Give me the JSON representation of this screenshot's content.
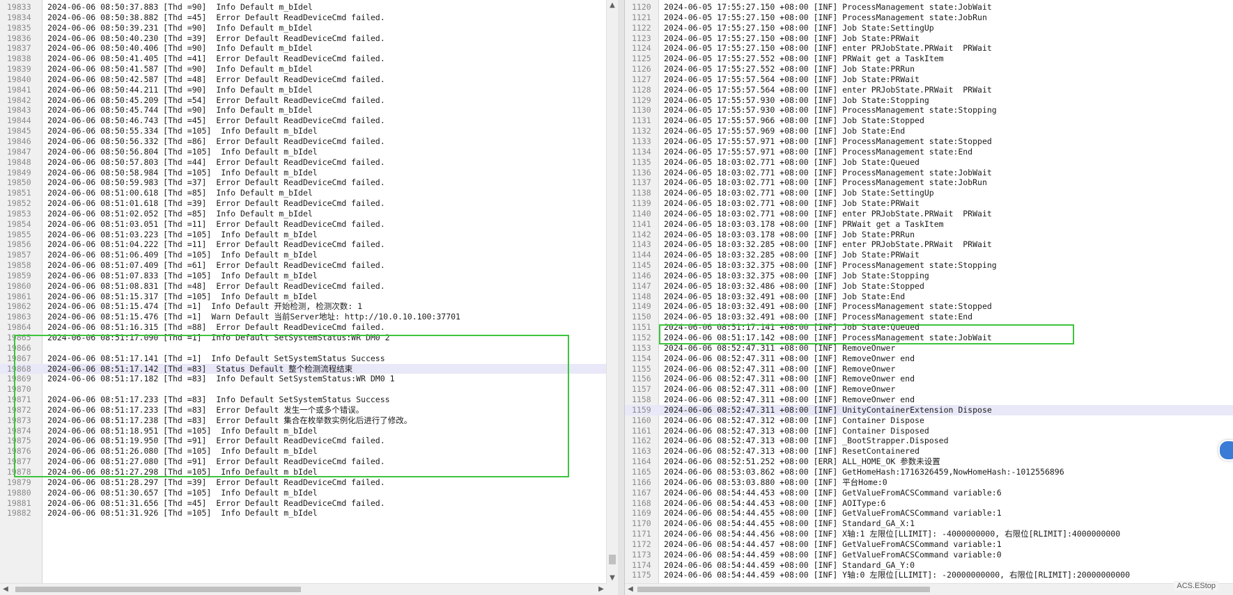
{
  "left_log": {
    "lines": [
      {
        "n": "19833",
        "t": "2024-06-06 08:50:37.883 [Thd =90]  Info Default m_bIdel"
      },
      {
        "n": "19834",
        "t": "2024-06-06 08:50:38.882 [Thd =45]  Error Default ReadDeviceCmd failed."
      },
      {
        "n": "19835",
        "t": "2024-06-06 08:50:39.231 [Thd =90]  Info Default m_bIdel"
      },
      {
        "n": "19836",
        "t": "2024-06-06 08:50:40.230 [Thd =39]  Error Default ReadDeviceCmd failed."
      },
      {
        "n": "19837",
        "t": "2024-06-06 08:50:40.406 [Thd =90]  Info Default m_bIdel"
      },
      {
        "n": "19838",
        "t": "2024-06-06 08:50:41.405 [Thd =41]  Error Default ReadDeviceCmd failed."
      },
      {
        "n": "19839",
        "t": "2024-06-06 08:50:41.587 [Thd =90]  Info Default m_bIdel"
      },
      {
        "n": "19840",
        "t": "2024-06-06 08:50:42.587 [Thd =48]  Error Default ReadDeviceCmd failed."
      },
      {
        "n": "19841",
        "t": "2024-06-06 08:50:44.211 [Thd =90]  Info Default m_bIdel"
      },
      {
        "n": "19842",
        "t": "2024-06-06 08:50:45.209 [Thd =54]  Error Default ReadDeviceCmd failed."
      },
      {
        "n": "19843",
        "t": "2024-06-06 08:50:45.744 [Thd =90]  Info Default m_bIdel"
      },
      {
        "n": "19844",
        "t": "2024-06-06 08:50:46.743 [Thd =45]  Error Default ReadDeviceCmd failed."
      },
      {
        "n": "19845",
        "t": "2024-06-06 08:50:55.334 [Thd =105]  Info Default m_bIdel"
      },
      {
        "n": "19846",
        "t": "2024-06-06 08:50:56.332 [Thd =86]  Error Default ReadDeviceCmd failed."
      },
      {
        "n": "19847",
        "t": "2024-06-06 08:50:56.804 [Thd =105]  Info Default m_bIdel"
      },
      {
        "n": "19848",
        "t": "2024-06-06 08:50:57.803 [Thd =44]  Error Default ReadDeviceCmd failed."
      },
      {
        "n": "19849",
        "t": "2024-06-06 08:50:58.984 [Thd =105]  Info Default m_bIdel"
      },
      {
        "n": "19850",
        "t": "2024-06-06 08:50:59.983 [Thd =37]  Error Default ReadDeviceCmd failed."
      },
      {
        "n": "19851",
        "t": "2024-06-06 08:51:00.618 [Thd =85]  Info Default m_bIdel"
      },
      {
        "n": "19852",
        "t": "2024-06-06 08:51:01.618 [Thd =39]  Error Default ReadDeviceCmd failed."
      },
      {
        "n": "19853",
        "t": "2024-06-06 08:51:02.052 [Thd =85]  Info Default m_bIdel"
      },
      {
        "n": "19854",
        "t": "2024-06-06 08:51:03.051 [Thd =11]  Error Default ReadDeviceCmd failed."
      },
      {
        "n": "19855",
        "t": "2024-06-06 08:51:03.223 [Thd =105]  Info Default m_bIdel"
      },
      {
        "n": "19856",
        "t": "2024-06-06 08:51:04.222 [Thd =11]  Error Default ReadDeviceCmd failed."
      },
      {
        "n": "19857",
        "t": "2024-06-06 08:51:06.409 [Thd =105]  Info Default m_bIdel"
      },
      {
        "n": "19858",
        "t": "2024-06-06 08:51:07.409 [Thd =61]  Error Default ReadDeviceCmd failed."
      },
      {
        "n": "19859",
        "t": "2024-06-06 08:51:07.833 [Thd =105]  Info Default m_bIdel"
      },
      {
        "n": "19860",
        "t": "2024-06-06 08:51:08.831 [Thd =48]  Error Default ReadDeviceCmd failed."
      },
      {
        "n": "19861",
        "t": "2024-06-06 08:51:15.317 [Thd =105]  Info Default m_bIdel"
      },
      {
        "n": "19862",
        "t": "2024-06-06 08:51:15.474 [Thd =1]  Info Default 开始检测, 检测次数: 1"
      },
      {
        "n": "19863",
        "t": "2024-06-06 08:51:15.476 [Thd =1]  Warn Default 当前Server地址: http://10.0.10.100:37701"
      },
      {
        "n": "19864",
        "t": "2024-06-06 08:51:16.315 [Thd =88]  Error Default ReadDeviceCmd failed."
      },
      {
        "n": "19865",
        "t": "2024-06-06 08:51:17.090 [Thd =1]  Info Default SetSystemStatus:WR DM0 2"
      },
      {
        "n": "19866",
        "t": ""
      },
      {
        "n": "19867",
        "t": "2024-06-06 08:51:17.141 [Thd =1]  Info Default SetSystemStatus Success"
      },
      {
        "n": "19868",
        "t": "2024-06-06 08:51:17.142 [Thd =83]  Status Default 整个检测流程结束"
      },
      {
        "n": "19869",
        "t": "2024-06-06 08:51:17.182 [Thd =83]  Info Default SetSystemStatus:WR DM0 1"
      },
      {
        "n": "19870",
        "t": ""
      },
      {
        "n": "19871",
        "t": "2024-06-06 08:51:17.233 [Thd =83]  Info Default SetSystemStatus Success"
      },
      {
        "n": "19872",
        "t": "2024-06-06 08:51:17.233 [Thd =83]  Error Default 发生一个或多个错误。"
      },
      {
        "n": "19873",
        "t": "2024-06-06 08:51:17.238 [Thd =83]  Error Default 集合在枚举数实例化后进行了修改。"
      },
      {
        "n": "19874",
        "t": "2024-06-06 08:51:18.951 [Thd =105]  Info Default m_bIdel"
      },
      {
        "n": "19875",
        "t": "2024-06-06 08:51:19.950 [Thd =91]  Error Default ReadDeviceCmd failed."
      },
      {
        "n": "19876",
        "t": "2024-06-06 08:51:26.080 [Thd =105]  Info Default m_bIdel"
      },
      {
        "n": "19877",
        "t": "2024-06-06 08:51:27.080 [Thd =91]  Error Default ReadDeviceCmd failed."
      },
      {
        "n": "19878",
        "t": "2024-06-06 08:51:27.298 [Thd =105]  Info Default m_bIdel"
      },
      {
        "n": "19879",
        "t": "2024-06-06 08:51:28.297 [Thd =39]  Error Default ReadDeviceCmd failed."
      },
      {
        "n": "19880",
        "t": "2024-06-06 08:51:30.657 [Thd =105]  Info Default m_bIdel"
      },
      {
        "n": "19881",
        "t": "2024-06-06 08:51:31.656 [Thd =45]  Error Default ReadDeviceCmd failed."
      },
      {
        "n": "19882",
        "t": "2024-06-06 08:51:31.926 [Thd =105]  Info Default m_bIdel"
      }
    ],
    "highlighted_line": "19868"
  },
  "right_log": {
    "lines": [
      {
        "n": "1120",
        "t": "2024-06-05 17:55:27.150 +08:00 [INF] ProcessManagement state:JobWait"
      },
      {
        "n": "1121",
        "t": "2024-06-05 17:55:27.150 +08:00 [INF] ProcessManagement state:JobRun"
      },
      {
        "n": "1122",
        "t": "2024-06-05 17:55:27.150 +08:00 [INF] Job State:SettingUp"
      },
      {
        "n": "1123",
        "t": "2024-06-05 17:55:27.150 +08:00 [INF] Job State:PRWait"
      },
      {
        "n": "1124",
        "t": "2024-06-05 17:55:27.150 +08:00 [INF] enter PRJobState.PRWait  PRWait"
      },
      {
        "n": "1125",
        "t": "2024-06-05 17:55:27.552 +08:00 [INF] PRWait get a TaskItem"
      },
      {
        "n": "1126",
        "t": "2024-06-05 17:55:27.552 +08:00 [INF] Job State:PRRun"
      },
      {
        "n": "1127",
        "t": "2024-06-05 17:55:57.564 +08:00 [INF] Job State:PRWait"
      },
      {
        "n": "1128",
        "t": "2024-06-05 17:55:57.564 +08:00 [INF] enter PRJobState.PRWait  PRWait"
      },
      {
        "n": "1129",
        "t": "2024-06-05 17:55:57.930 +08:00 [INF] Job State:Stopping"
      },
      {
        "n": "1130",
        "t": "2024-06-05 17:55:57.930 +08:00 [INF] ProcessManagement state:Stopping"
      },
      {
        "n": "1131",
        "t": "2024-06-05 17:55:57.966 +08:00 [INF] Job State:Stopped"
      },
      {
        "n": "1132",
        "t": "2024-06-05 17:55:57.969 +08:00 [INF] Job State:End"
      },
      {
        "n": "1133",
        "t": "2024-06-05 17:55:57.971 +08:00 [INF] ProcessManagement state:Stopped"
      },
      {
        "n": "1134",
        "t": "2024-06-05 17:55:57.971 +08:00 [INF] ProcessManagement state:End"
      },
      {
        "n": "1135",
        "t": "2024-06-05 18:03:02.771 +08:00 [INF] Job State:Queued"
      },
      {
        "n": "1136",
        "t": "2024-06-05 18:03:02.771 +08:00 [INF] ProcessManagement state:JobWait"
      },
      {
        "n": "1137",
        "t": "2024-06-05 18:03:02.771 +08:00 [INF] ProcessManagement state:JobRun"
      },
      {
        "n": "1138",
        "t": "2024-06-05 18:03:02.771 +08:00 [INF] Job State:SettingUp"
      },
      {
        "n": "1139",
        "t": "2024-06-05 18:03:02.771 +08:00 [INF] Job State:PRWait"
      },
      {
        "n": "1140",
        "t": "2024-06-05 18:03:02.771 +08:00 [INF] enter PRJobState.PRWait  PRWait"
      },
      {
        "n": "1141",
        "t": "2024-06-05 18:03:03.178 +08:00 [INF] PRWait get a TaskItem"
      },
      {
        "n": "1142",
        "t": "2024-06-05 18:03:03.178 +08:00 [INF] Job State:PRRun"
      },
      {
        "n": "1143",
        "t": "2024-06-05 18:03:32.285 +08:00 [INF] enter PRJobState.PRWait  PRWait"
      },
      {
        "n": "1144",
        "t": "2024-06-05 18:03:32.285 +08:00 [INF] Job State:PRWait"
      },
      {
        "n": "1145",
        "t": "2024-06-05 18:03:32.375 +08:00 [INF] ProcessManagement state:Stopping"
      },
      {
        "n": "1146",
        "t": "2024-06-05 18:03:32.375 +08:00 [INF] Job State:Stopping"
      },
      {
        "n": "1147",
        "t": "2024-06-05 18:03:32.486 +08:00 [INF] Job State:Stopped"
      },
      {
        "n": "1148",
        "t": "2024-06-05 18:03:32.491 +08:00 [INF] Job State:End"
      },
      {
        "n": "1149",
        "t": "2024-06-05 18:03:32.491 +08:00 [INF] ProcessManagement state:Stopped"
      },
      {
        "n": "1150",
        "t": "2024-06-05 18:03:32.491 +08:00 [INF] ProcessManagement state:End"
      },
      {
        "n": "1151",
        "t": "2024-06-06 08:51:17.141 +08:00 [INF] Job State:Queued"
      },
      {
        "n": "1152",
        "t": "2024-06-06 08:51:17.142 +08:00 [INF] ProcessManagement state:JobWait"
      },
      {
        "n": "1153",
        "t": "2024-06-06 08:52:47.311 +08:00 [INF] RemoveOnwer"
      },
      {
        "n": "1154",
        "t": "2024-06-06 08:52:47.311 +08:00 [INF] RemoveOnwer end"
      },
      {
        "n": "1155",
        "t": "2024-06-06 08:52:47.311 +08:00 [INF] RemoveOnwer"
      },
      {
        "n": "1156",
        "t": "2024-06-06 08:52:47.311 +08:00 [INF] RemoveOnwer end"
      },
      {
        "n": "1157",
        "t": "2024-06-06 08:52:47.311 +08:00 [INF] RemoveOnwer"
      },
      {
        "n": "1158",
        "t": "2024-06-06 08:52:47.311 +08:00 [INF] RemoveOnwer end"
      },
      {
        "n": "1159",
        "t": "2024-06-06 08:52:47.311 +08:00 [INF] UnityContainerExtension Dispose"
      },
      {
        "n": "1160",
        "t": "2024-06-06 08:52:47.312 +08:00 [INF] Container Dispose"
      },
      {
        "n": "1161",
        "t": "2024-06-06 08:52:47.313 +08:00 [INF] Container Disposed"
      },
      {
        "n": "1162",
        "t": "2024-06-06 08:52:47.313 +08:00 [INF] _BootStrapper.Disposed"
      },
      {
        "n": "1163",
        "t": "2024-06-06 08:52:47.313 +08:00 [INF] ResetContainered"
      },
      {
        "n": "1164",
        "t": "2024-06-06 08:52:51.252 +08:00 [ERR] ALL_HOME_OK 参数未设置"
      },
      {
        "n": "1165",
        "t": "2024-06-06 08:53:03.862 +08:00 [INF] GetHomeHash:1716326459,NowHomeHash:-1012556896"
      },
      {
        "n": "1166",
        "t": "2024-06-06 08:53:03.880 +08:00 [INF] 平台Home:0"
      },
      {
        "n": "1167",
        "t": "2024-06-06 08:54:44.453 +08:00 [INF] GetValueFromACSCommand variable:6"
      },
      {
        "n": "1168",
        "t": "2024-06-06 08:54:44.453 +08:00 [INF] AOIType:6"
      },
      {
        "n": "1169",
        "t": "2024-06-06 08:54:44.455 +08:00 [INF] GetValueFromACSCommand variable:1"
      },
      {
        "n": "1170",
        "t": "2024-06-06 08:54:44.455 +08:00 [INF] Standard_GA_X:1"
      },
      {
        "n": "1171",
        "t": "2024-06-06 08:54:44.456 +08:00 [INF] X轴:1 左限位[LLIMIT]: -4000000000, 右限位[RLIMIT]:4000000000"
      },
      {
        "n": "1172",
        "t": "2024-06-06 08:54:44.457 +08:00 [INF] GetValueFromACSCommand variable:1"
      },
      {
        "n": "1173",
        "t": "2024-06-06 08:54:44.459 +08:00 [INF] GetValueFromACSCommand variable:0"
      },
      {
        "n": "1174",
        "t": "2024-06-06 08:54:44.459 +08:00 [INF] Standard_GA_Y:0"
      },
      {
        "n": "1175",
        "t": "2024-06-06 08:54:44.459 +08:00 [INF] Y轴:0 左限位[LLIMIT]: -20000000000, 右限位[RLIMIT]:20000000000"
      }
    ],
    "highlighted_line": "1159"
  },
  "status": {
    "label": "ACS.EStop"
  },
  "colors": {
    "highlight_box": "#3cc43c",
    "current_line": "#e8e8f8"
  },
  "icons": {
    "scroll_up": "▲",
    "scroll_down": "▼",
    "scroll_left": "◀",
    "scroll_right": "▶"
  }
}
